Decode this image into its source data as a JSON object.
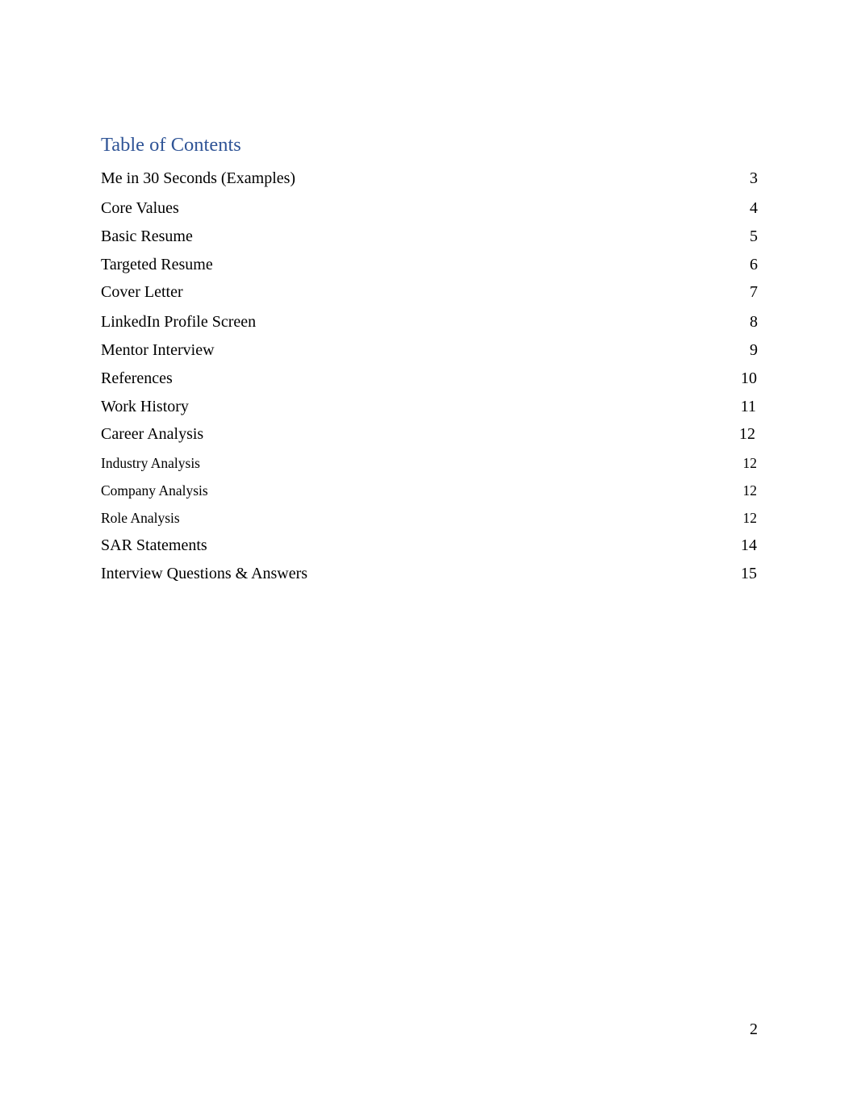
{
  "document": {
    "toc_title": "Table of Contents",
    "entries": [
      {
        "label": "Me in 30 Seconds (Examples)",
        "page": "3",
        "level": 1
      },
      {
        "label": "Core Values",
        "page": "4",
        "level": 1
      },
      {
        "label": "Basic Resume",
        "page": "5",
        "level": 1
      },
      {
        "label": "Targeted Resume",
        "page": "6",
        "level": 1
      },
      {
        "label": "Cover Letter",
        "page": "7",
        "level": 1
      },
      {
        "label": "LinkedIn Profile Screen",
        "page": "8",
        "level": 1
      },
      {
        "label": "Mentor Interview",
        "page": "9",
        "level": 1
      },
      {
        "label": "References",
        "page": "10",
        "level": 1
      },
      {
        "label": "Work History",
        "page": "11",
        "level": 1
      },
      {
        "label": "Career Analysis",
        "page": "12",
        "level": 1
      },
      {
        "label": "Industry Analysis",
        "page": "12",
        "level": 2
      },
      {
        "label": "Company Analysis",
        "page": "12",
        "level": 2
      },
      {
        "label": "Role Analysis",
        "page": "12",
        "level": 2
      },
      {
        "label": "SAR Statements",
        "page": "14",
        "level": 1
      },
      {
        "label": "Interview Questions & Answers",
        "page": "15",
        "level": 1
      }
    ],
    "page_number": "2",
    "colors": {
      "heading": "#2F5496",
      "text": "#000000"
    }
  }
}
